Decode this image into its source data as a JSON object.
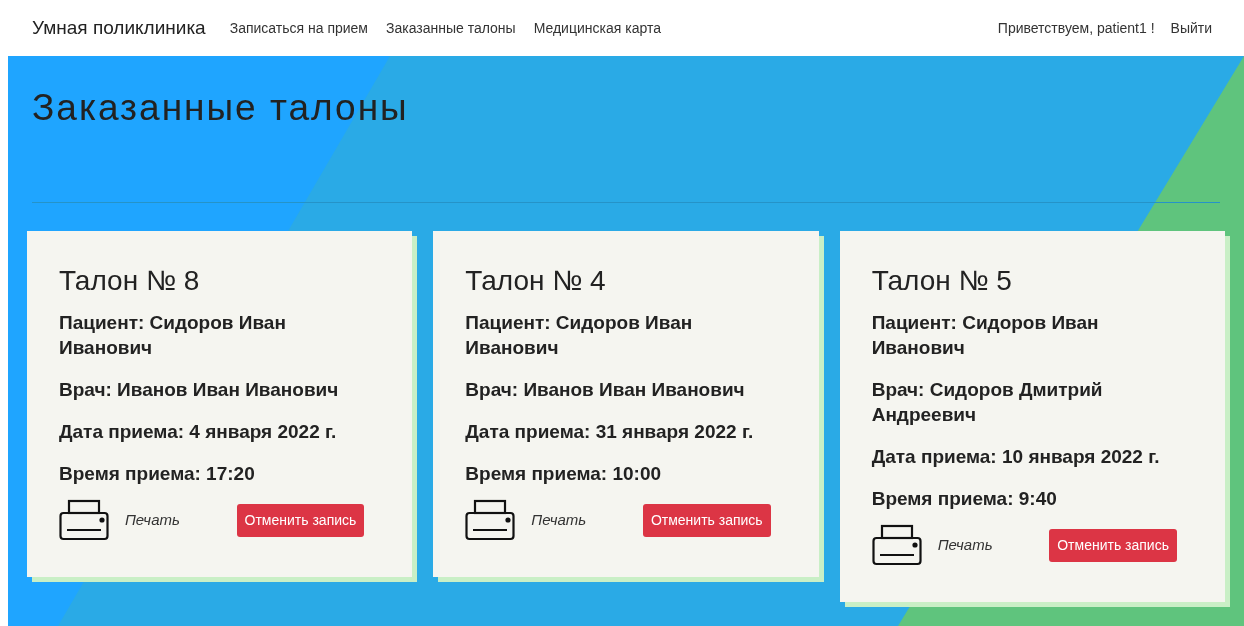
{
  "navbar": {
    "brand": "Умная поликлиника",
    "links": [
      "Записаться на прием",
      "Заказанные талоны",
      "Медицинская карта"
    ],
    "greeting": "Приветствуем, patient1 !",
    "logout": "Выйти"
  },
  "page_title": "Заказанные талоны",
  "tickets": [
    {
      "title": "Талон № 8",
      "lines": [
        "Пациент: Сидоров Иван Иванович",
        "Врач: Иванов Иван Иванович",
        "Дата приема: 4 января 2022 г.",
        "Время приема: 17:20"
      ],
      "print_label": "Печать",
      "cancel_button": "Отменить запись"
    },
    {
      "title": "Талон № 4",
      "lines": [
        "Пациент: Сидоров Иван Иванович",
        "Врач: Иванов Иван Иванович",
        "Дата приема: 31 января 2022 г.",
        "Время приема: 10:00"
      ],
      "print_label": "Печать",
      "cancel_button": "Отменить запись"
    },
    {
      "title": "Талон № 5",
      "lines": [
        "Пациент: Сидоров Иван Иванович",
        "Врач: Сидоров Дмитрий Андреевич",
        "Дата приема: 10 января 2022 г.",
        "Время приема: 9:40"
      ],
      "print_label": "Печать",
      "cancel_button": "Отменить запись"
    }
  ]
}
